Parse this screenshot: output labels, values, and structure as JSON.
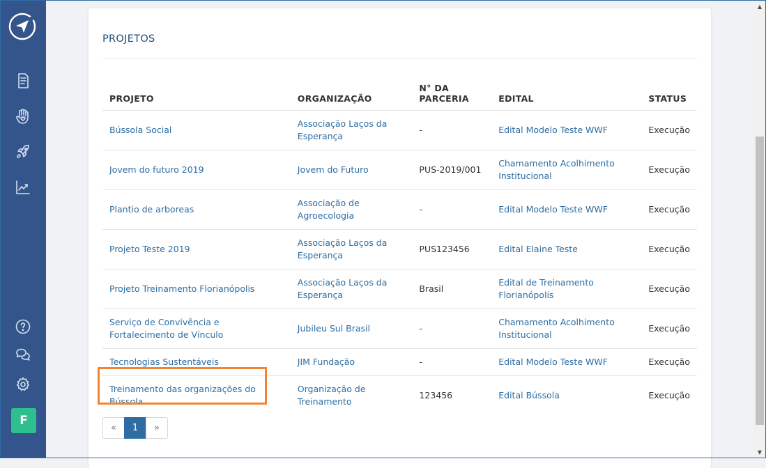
{
  "sidebar": {
    "logo_icon": "compass-logo-icon",
    "nav": [
      "document-icon",
      "hand-heart-icon",
      "rocket-icon",
      "chart-line-icon"
    ],
    "bottom": [
      "help-icon",
      "chat-icon",
      "gear-icon"
    ],
    "avatar_initial": "F",
    "avatar_color": "#2fbf8f",
    "background": "#34558b"
  },
  "section": {
    "title": "PROJETOS"
  },
  "table": {
    "headers": {
      "projeto": "PROJETO",
      "organizacao": "ORGANIZAÇÃO",
      "parceria_line1": "N° DA",
      "parceria_line2": "PARCERIA",
      "edital": "EDITAL",
      "status": "STATUS"
    },
    "rows": [
      {
        "projeto": "Bússola Social",
        "organizacao": "Associação Laços da Esperança",
        "parceria": "-",
        "edital": "Edital Modelo Teste WWF",
        "status": "Execução"
      },
      {
        "projeto": "Jovem do futuro 2019",
        "organizacao": "Jovem do Futuro",
        "parceria": "PUS-2019/001",
        "edital": "Chamamento Acolhimento Institucional",
        "status": "Execução"
      },
      {
        "projeto": "Plantio de arboreas",
        "organizacao": "Associação de Agroecologia",
        "parceria": "-",
        "edital": "Edital Modelo Teste WWF",
        "status": "Execução"
      },
      {
        "projeto": "Projeto Teste 2019",
        "organizacao": "Associação Laços da Esperança",
        "parceria": "PUS123456",
        "edital": "Edital Elaine Teste",
        "status": "Execução"
      },
      {
        "projeto": "Projeto Treinamento Florianópolis",
        "organizacao": "Associação Laços da Esperança",
        "parceria": "Brasil",
        "edital": "Edital de Treinamento Florianópolis",
        "status": "Execução"
      },
      {
        "projeto": "Serviço de Convivência e Fortalecimento de Vínculo",
        "organizacao": "Jubileu Sul Brasil",
        "parceria": "-",
        "edital": "Chamamento Acolhimento Institucional",
        "status": "Execução"
      },
      {
        "projeto": "Tecnologias Sustentáveis",
        "organizacao": "JIM Fundação",
        "parceria": "-",
        "edital": "Edital Modelo Teste WWF",
        "status": "Execução"
      },
      {
        "projeto": "Treinamento das organizações do Bússola",
        "organizacao": "Organização de Treinamento",
        "parceria": "123456",
        "edital": "Edital Bússola",
        "status": "Execução"
      }
    ]
  },
  "pagination": {
    "prev": "«",
    "current": "1",
    "next": "»"
  },
  "colors": {
    "link": "#2d6da3",
    "highlight": "#f58230",
    "active_page": "#2d6da3"
  }
}
